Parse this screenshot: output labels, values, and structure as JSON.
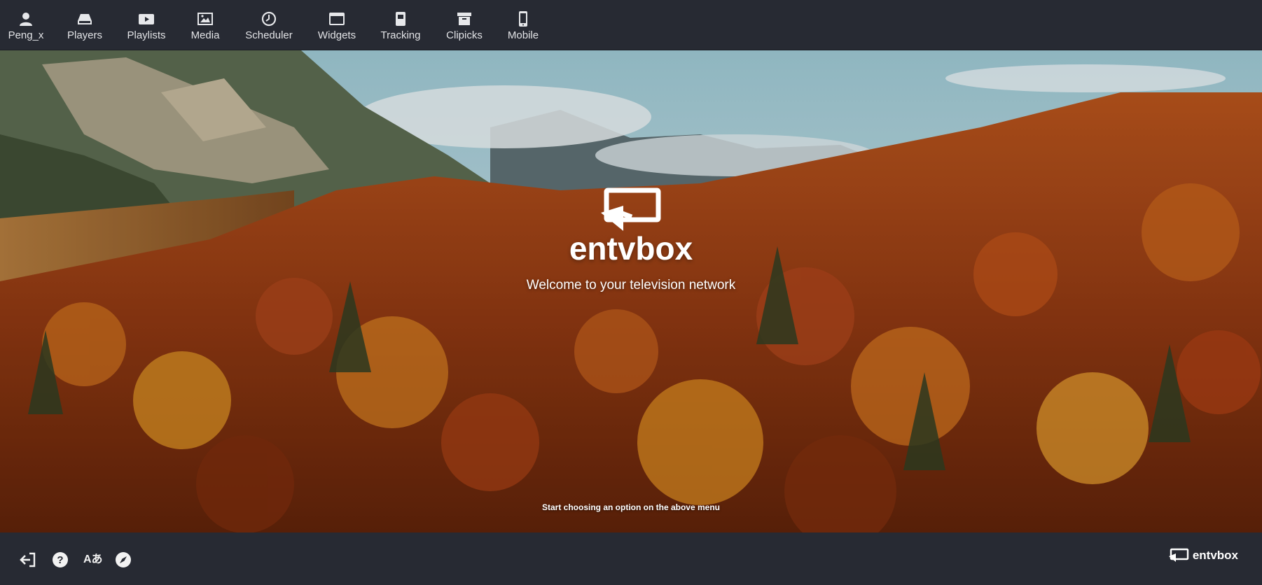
{
  "nav": {
    "items": [
      {
        "label": "Peng_x",
        "icon": "user-icon"
      },
      {
        "label": "Players",
        "icon": "player-icon"
      },
      {
        "label": "Playlists",
        "icon": "playlist-icon"
      },
      {
        "label": "Media",
        "icon": "media-icon"
      },
      {
        "label": "Scheduler",
        "icon": "clock-icon"
      },
      {
        "label": "Widgets",
        "icon": "window-icon"
      },
      {
        "label": "Tracking",
        "icon": "tracking-icon"
      },
      {
        "label": "Clipicks",
        "icon": "archive-icon"
      },
      {
        "label": "Mobile",
        "icon": "mobile-icon"
      }
    ]
  },
  "hero": {
    "brand": "entvbox",
    "welcome": "Welcome to your television network",
    "hint": "Start choosing an option on the above menu"
  },
  "footer": {
    "icons": [
      "logout-icon",
      "help-icon",
      "language-icon",
      "compass-icon"
    ],
    "language_glyph": "Aあ",
    "brand": "entvbox"
  },
  "colors": {
    "nav_bg": "#272a33",
    "text": "#e6e7ea",
    "brand_text": "#ffffff"
  }
}
